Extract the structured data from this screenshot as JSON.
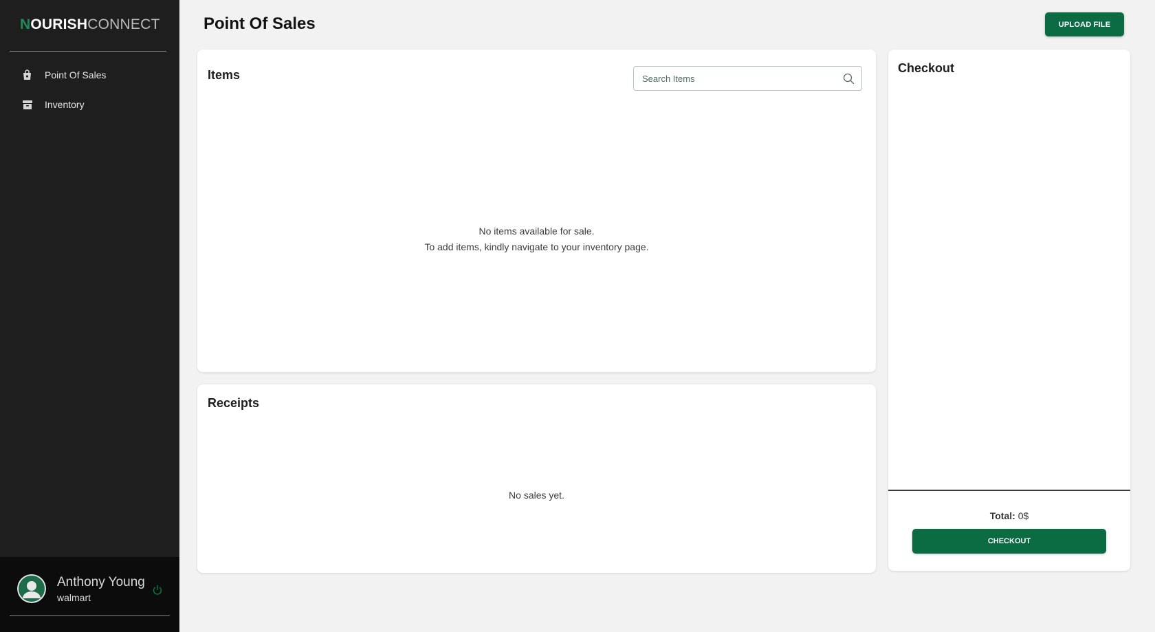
{
  "brand": {
    "logo_n": "N",
    "logo_ourish": "OURISH",
    "logo_connect": "CONNECT"
  },
  "sidebar": {
    "items": [
      {
        "label": "Point Of Sales",
        "icon": "shopping-bag-icon"
      },
      {
        "label": "Inventory",
        "icon": "archive-box-icon"
      }
    ]
  },
  "user": {
    "name": "Anthony Young",
    "org": "walmart",
    "avatar_icon": "user-avatar-icon",
    "logout_icon": "power-icon"
  },
  "header": {
    "title": "Point Of Sales",
    "upload_label": "UPLOAD FILE"
  },
  "items_panel": {
    "title": "Items",
    "search_placeholder": "Search Items",
    "empty_line1": "No items available for sale.",
    "empty_line2": "To add items, kindly navigate to your inventory page."
  },
  "receipts_panel": {
    "title": "Receipts",
    "empty_message": "No sales yet."
  },
  "checkout_panel": {
    "title": "Checkout",
    "total_label": "Total:",
    "total_value": "0$",
    "checkout_label": "CHECKOUT"
  },
  "colors": {
    "accent": "#0b6b43",
    "sidebar_bg": "#1e1e1e",
    "page_bg": "#f2f2f2"
  }
}
